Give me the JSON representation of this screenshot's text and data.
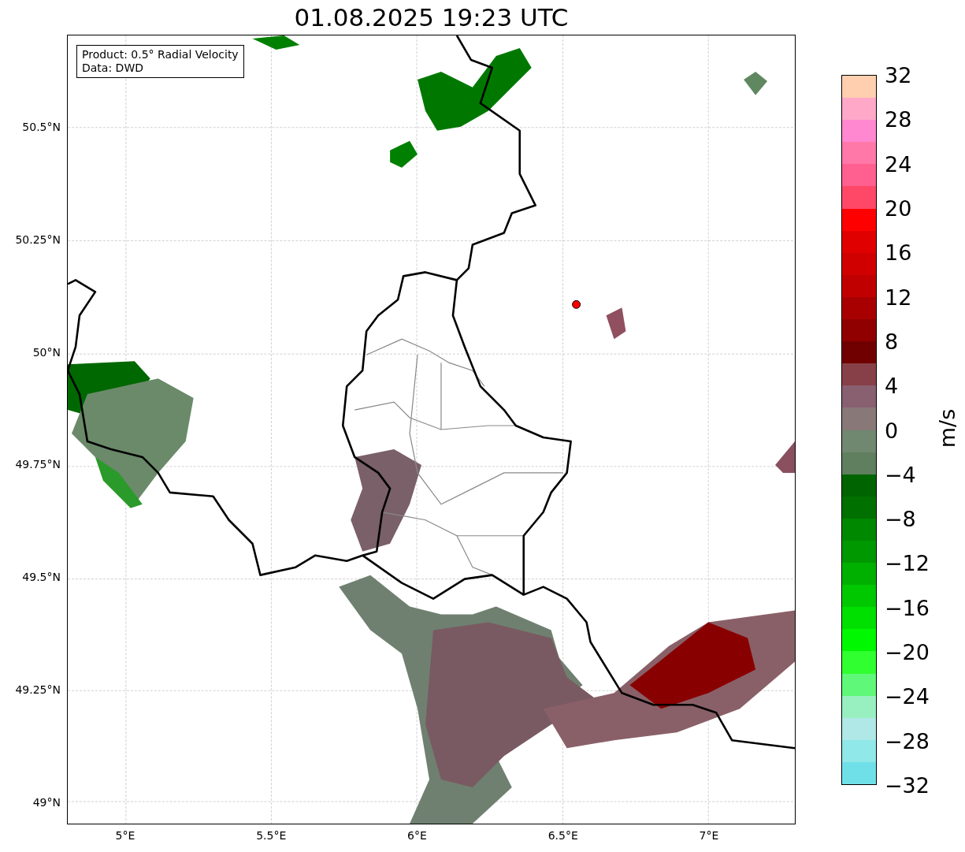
{
  "title": "01.08.2025 19:23 UTC",
  "map": {
    "info_box": [
      "Product: 0.5° Radial Velocity",
      "Data: DWD"
    ],
    "y_ticks": [
      "50.5°N",
      "50.25°N",
      "50°N",
      "49.75°N",
      "49.5°N",
      "49.25°N",
      "49°N"
    ],
    "x_ticks": [
      "5°E",
      "5.5°E",
      "6°E",
      "6.5°E",
      "7°E"
    ]
  },
  "colorbar": {
    "label": "m/s",
    "ticks": [
      "32",
      "28",
      "24",
      "20",
      "16",
      "12",
      "8",
      "4",
      "0",
      "−4",
      "−8",
      "−12",
      "−16",
      "−20",
      "−24",
      "−28",
      "−32"
    ],
    "bands": [
      {
        "color": "#ffcfb0"
      },
      {
        "color": "#ffa8c8"
      },
      {
        "color": "#ff88d0"
      },
      {
        "color": "#ff78a8"
      },
      {
        "color": "#ff6090"
      },
      {
        "color": "#ff4868"
      },
      {
        "color": "#ff0000"
      },
      {
        "color": "#e00000"
      },
      {
        "color": "#d00000"
      },
      {
        "color": "#c00000"
      },
      {
        "color": "#a80000"
      },
      {
        "color": "#900000"
      },
      {
        "color": "#700000"
      },
      {
        "color": "#884048"
      },
      {
        "color": "#886070"
      },
      {
        "color": "#887878"
      },
      {
        "color": "#708870"
      },
      {
        "color": "#5f7f5f"
      },
      {
        "color": "#006400"
      },
      {
        "color": "#007000"
      },
      {
        "color": "#008800"
      },
      {
        "color": "#009800"
      },
      {
        "color": "#00b000"
      },
      {
        "color": "#00c800"
      },
      {
        "color": "#00e000"
      },
      {
        "color": "#00f800"
      },
      {
        "color": "#30ff30"
      },
      {
        "color": "#60f878"
      },
      {
        "color": "#98f0c0"
      },
      {
        "color": "#b0e8e8"
      },
      {
        "color": "#90e8e8"
      },
      {
        "color": "#70e0e8"
      }
    ]
  }
}
